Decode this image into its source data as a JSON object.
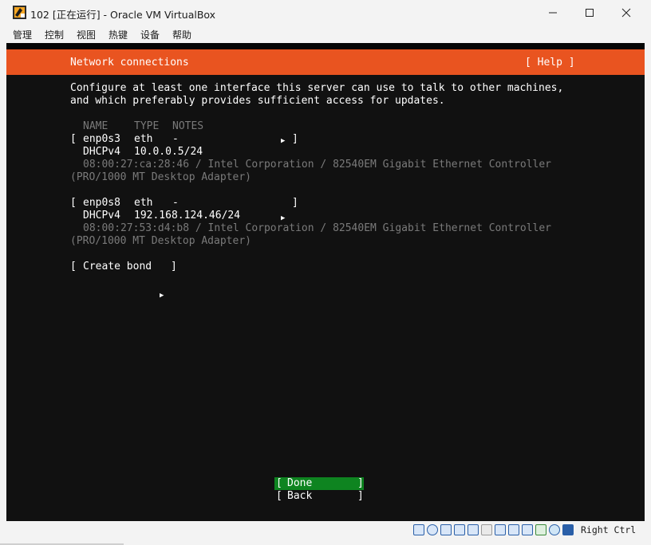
{
  "window": {
    "title": "102 [正在运行] - Oracle VM VirtualBox",
    "controls": [
      "minimize",
      "maximize",
      "close"
    ]
  },
  "menubar": {
    "items": [
      "管理",
      "控制",
      "视图",
      "热键",
      "设备",
      "帮助"
    ]
  },
  "installer": {
    "header_title": "Network connections",
    "help_button": "[ Help ]",
    "intro_line1": "Configure at least one interface this server can use to talk to other machines,",
    "intro_line2": "and which preferably provides sufficient access for updates.",
    "columns": {
      "name": "NAME",
      "type": "TYPE",
      "notes": "NOTES"
    },
    "interfaces": [
      {
        "name": "enp0s3",
        "type": "eth",
        "notes": "-",
        "method": "DHCPv4",
        "address": "10.0.0.5/24",
        "hw_line1": "08:00:27:ca:28:46 / Intel Corporation / 82540EM Gigabit Ethernet Controller",
        "hw_line2": "(PRO/1000 MT Desktop Adapter)"
      },
      {
        "name": "enp0s8",
        "type": "eth",
        "notes": "-",
        "method": "DHCPv4",
        "address": "192.168.124.46/24",
        "hw_line1": "08:00:27:53:d4:b8 / Intel Corporation / 82540EM Gigabit Ethernet Controller",
        "hw_line2": "(PRO/1000 MT Desktop Adapter)"
      }
    ],
    "create_bond_label": "Create bond",
    "done_label": "Done",
    "back_label": "Back"
  },
  "statusbar": {
    "icons": [
      "hard-disk-icon",
      "optical-disk-icon",
      "audio-icon",
      "network-icon",
      "usb-icon",
      "shared-folder-icon",
      "display-icon",
      "video-capture-icon",
      "recording-icon",
      "virtualization-icon",
      "mouse-integration-icon",
      "keyboard-icon"
    ],
    "host_key": "Right Ctrl"
  },
  "colors": {
    "accent": "#e95420",
    "done_green": "#0e8420",
    "terminal_bg": "#111111",
    "dim_text": "#7a7a7a"
  }
}
